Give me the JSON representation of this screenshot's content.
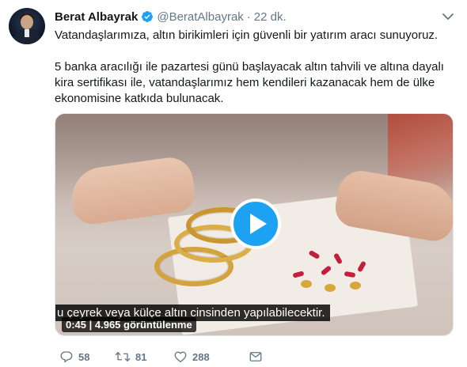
{
  "tweet": {
    "author_name": "Berat Albayrak",
    "handle": "@BeratAlbayrak",
    "separator": "·",
    "time": "22 dk.",
    "paragraphs": [
      "Vatandaşlarımıza, altın birikimleri için güvenli bir yatırım aracı sunuyoruz.",
      "5 banka aracılığı ile pazartesi günü başlayacak altın tahvili ve altına dayalı kira sertifikası ile, vatandaşlarımız hem kendileri kazanacak hem de ülke ekonomisine katkıda bulunacak."
    ]
  },
  "video": {
    "subtitle": "u çeyrek veya külçe altın cinsinden yapılabilecektir.",
    "duration_views": "0:45 | 4.965 görüntülenme",
    "play_color": "#1da1f2"
  },
  "actions": {
    "reply_count": "58",
    "retweet_count": "81",
    "like_count": "288"
  },
  "icons": {
    "verified": "verified-badge-icon",
    "caret": "chevron-down-icon",
    "reply": "reply-icon",
    "retweet": "retweet-icon",
    "like": "heart-icon",
    "message": "direct-message-icon"
  },
  "colors": {
    "accent": "#1da1f2",
    "muted": "#657786",
    "text": "#14171a"
  }
}
